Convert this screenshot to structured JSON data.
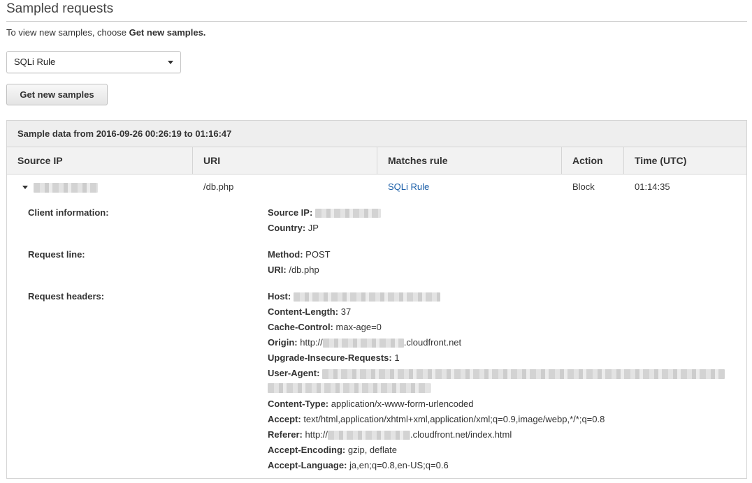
{
  "page": {
    "title": "Sampled requests",
    "intro_prefix": "To view new samples, choose ",
    "intro_bold": "Get new samples."
  },
  "rule_select": {
    "selected": "SQLi Rule"
  },
  "get_samples_button": {
    "label": "Get new samples"
  },
  "sample_table": {
    "header": "Sample data from 2016-09-26 00:26:19 to 01:16:47",
    "columns": [
      "Source IP",
      "URI",
      "Matches rule",
      "Action",
      "Time (UTC)"
    ],
    "rows": [
      {
        "source_ip": "",
        "uri": "/db.php",
        "matches_rule": "SQLi Rule",
        "action": "Block",
        "time": "01:14:35"
      }
    ]
  },
  "details": {
    "client_information": {
      "label": "Client information:",
      "source_ip_key": "Source IP:",
      "country_key": "Country:",
      "country_value": "JP"
    },
    "request_line": {
      "label": "Request line:",
      "method_key": "Method:",
      "method_value": "POST",
      "uri_key": "URI:",
      "uri_value": "/db.php"
    },
    "request_headers": {
      "label": "Request headers:",
      "host_key": "Host:",
      "content_length_key": "Content-Length:",
      "content_length_value": "37",
      "cache_control_key": "Cache-Control:",
      "cache_control_value": "max-age=0",
      "origin_key": "Origin:",
      "origin_prefix": "http://",
      "origin_suffix": ".cloudfront.net",
      "upgrade_key": "Upgrade-Insecure-Requests:",
      "upgrade_value": "1",
      "user_agent_key": "User-Agent:",
      "content_type_key": "Content-Type:",
      "content_type_value": "application/x-www-form-urlencoded",
      "accept_key": "Accept:",
      "accept_value": "text/html,application/xhtml+xml,application/xml;q=0.9,image/webp,*/*;q=0.8",
      "referer_key": "Referer:",
      "referer_prefix": "http://",
      "referer_suffix": ".cloudfront.net/index.html",
      "accept_encoding_key": "Accept-Encoding:",
      "accept_encoding_value": "gzip, deflate",
      "accept_language_key": "Accept-Language:",
      "accept_language_value": "ja,en;q=0.8,en-US;q=0.6"
    }
  },
  "colors": {
    "link": "#1a5ea8",
    "panel_header_bg": "#eeeeee",
    "border": "#d5d5d5"
  },
  "icons": {
    "select_caret": "chevron-down-icon",
    "row_expand": "caret-down-icon"
  }
}
